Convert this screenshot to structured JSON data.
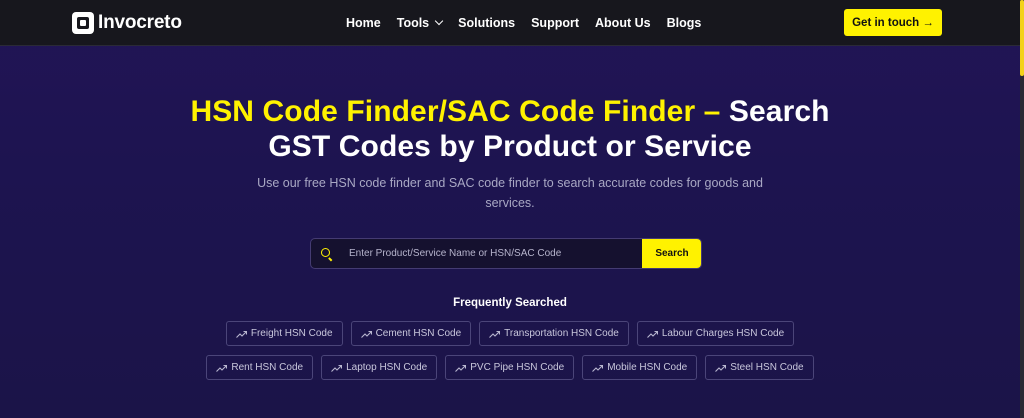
{
  "brand": {
    "name": "Invocreto"
  },
  "nav": {
    "items": [
      {
        "label": "Home"
      },
      {
        "label": "Tools",
        "has_dropdown": true
      },
      {
        "label": "Solutions"
      },
      {
        "label": "Support"
      },
      {
        "label": "About Us"
      },
      {
        "label": "Blogs"
      }
    ],
    "cta_label": "Get in touch →"
  },
  "hero": {
    "title_highlight": "HSN Code Finder/SAC Code Finder –",
    "title_rest_1": "Search",
    "title_rest_2": "GST Codes by Product or Service",
    "subtitle": "Use our free HSN code finder and SAC code finder to search accurate codes for goods and services."
  },
  "search": {
    "placeholder": "Enter Product/Service Name or HSN/SAC Code",
    "button_label": "Search"
  },
  "frequent": {
    "heading": "Frequently Searched",
    "row1": [
      "Freight HSN Code",
      "Cement HSN Code",
      "Transportation HSN Code",
      "Labour Charges HSN Code"
    ],
    "row2": [
      "Rent HSN Code",
      "Laptop HSN Code",
      "PVC Pipe HSN Code",
      "Mobile HSN Code",
      "Steel HSN Code"
    ]
  },
  "colors": {
    "accent": "#fff200",
    "nav_bg": "#17171d",
    "hero_bg": "#1d1450"
  }
}
